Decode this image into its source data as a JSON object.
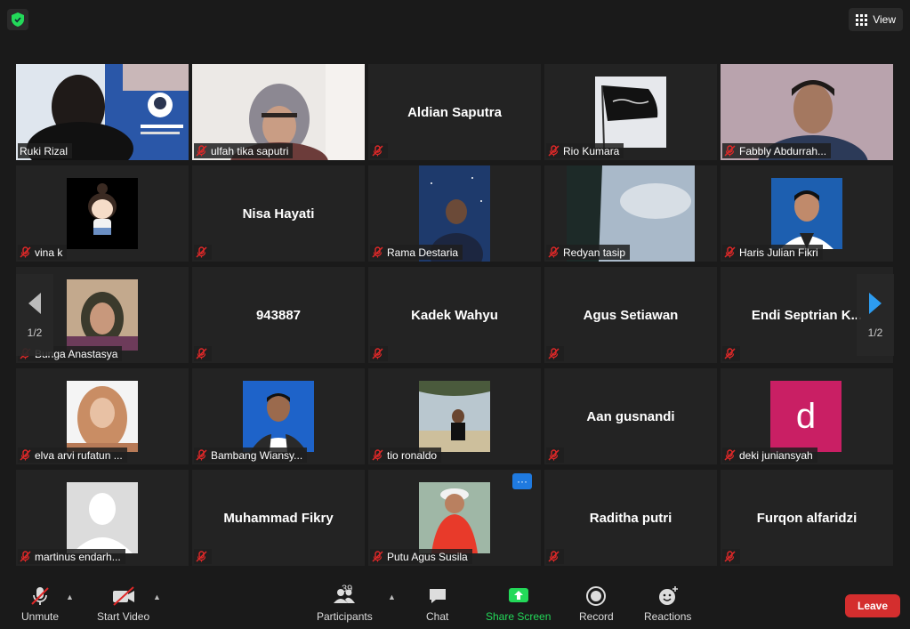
{
  "header": {
    "view_label": "View"
  },
  "tiles": [
    {
      "name": "Ruki Rizal",
      "active": true
    },
    {
      "name": "ulfah tika saputri"
    },
    {
      "name": "Aldian Saputra",
      "display": "Aldian Saputra"
    },
    {
      "name": "Rio Kumara"
    },
    {
      "name": "Fabbly Abdurrah..."
    },
    {
      "name": "vina k"
    },
    {
      "name": "Nisa Hayati",
      "display": "Nisa Hayati"
    },
    {
      "name": "Rama Destaria"
    },
    {
      "name": "Redyan tasip"
    },
    {
      "name": "Haris Julian Fikri"
    },
    {
      "name": "Bunga Anastasya"
    },
    {
      "name": "943887",
      "display": "943887"
    },
    {
      "name": "Kadek Wahyu",
      "display": "Kadek Wahyu"
    },
    {
      "name": "Agus Setiawan",
      "display": "Agus Setiawan"
    },
    {
      "name": "Endi Septrian K...",
      "display": "Endi Septrian K..."
    },
    {
      "name": "elva arvi rufatun ..."
    },
    {
      "name": "Bambang Wiansy..."
    },
    {
      "name": "tio ronaldo"
    },
    {
      "name": "Aan gusnandi",
      "display": "Aan gusnandi"
    },
    {
      "name": "deki juniansyah",
      "avatar_letter": "d",
      "avatar_color": "#c91f64"
    },
    {
      "name": "martinus endarh..."
    },
    {
      "name": "Muhammad Fikry",
      "display": "Muhammad Fikry"
    },
    {
      "name": "Putu Agus Susila"
    },
    {
      "name": "Raditha putri",
      "display": "Raditha putri"
    },
    {
      "name": "Furqon alfaridzi",
      "display": "Furqon alfaridzi"
    }
  ],
  "pager": {
    "left_page": "1/2",
    "right_page": "1/2"
  },
  "toolbar": {
    "unmute": "Unmute",
    "start_video": "Start Video",
    "participants": "Participants",
    "participants_count": "39",
    "chat": "Chat",
    "share_screen": "Share Screen",
    "record": "Record",
    "reactions": "Reactions",
    "leave": "Leave"
  },
  "colors": {
    "active_border": "#d7df7b",
    "share_green": "#23d959",
    "leave_red": "#d42e2e",
    "more_blue": "#1f7ae0"
  }
}
